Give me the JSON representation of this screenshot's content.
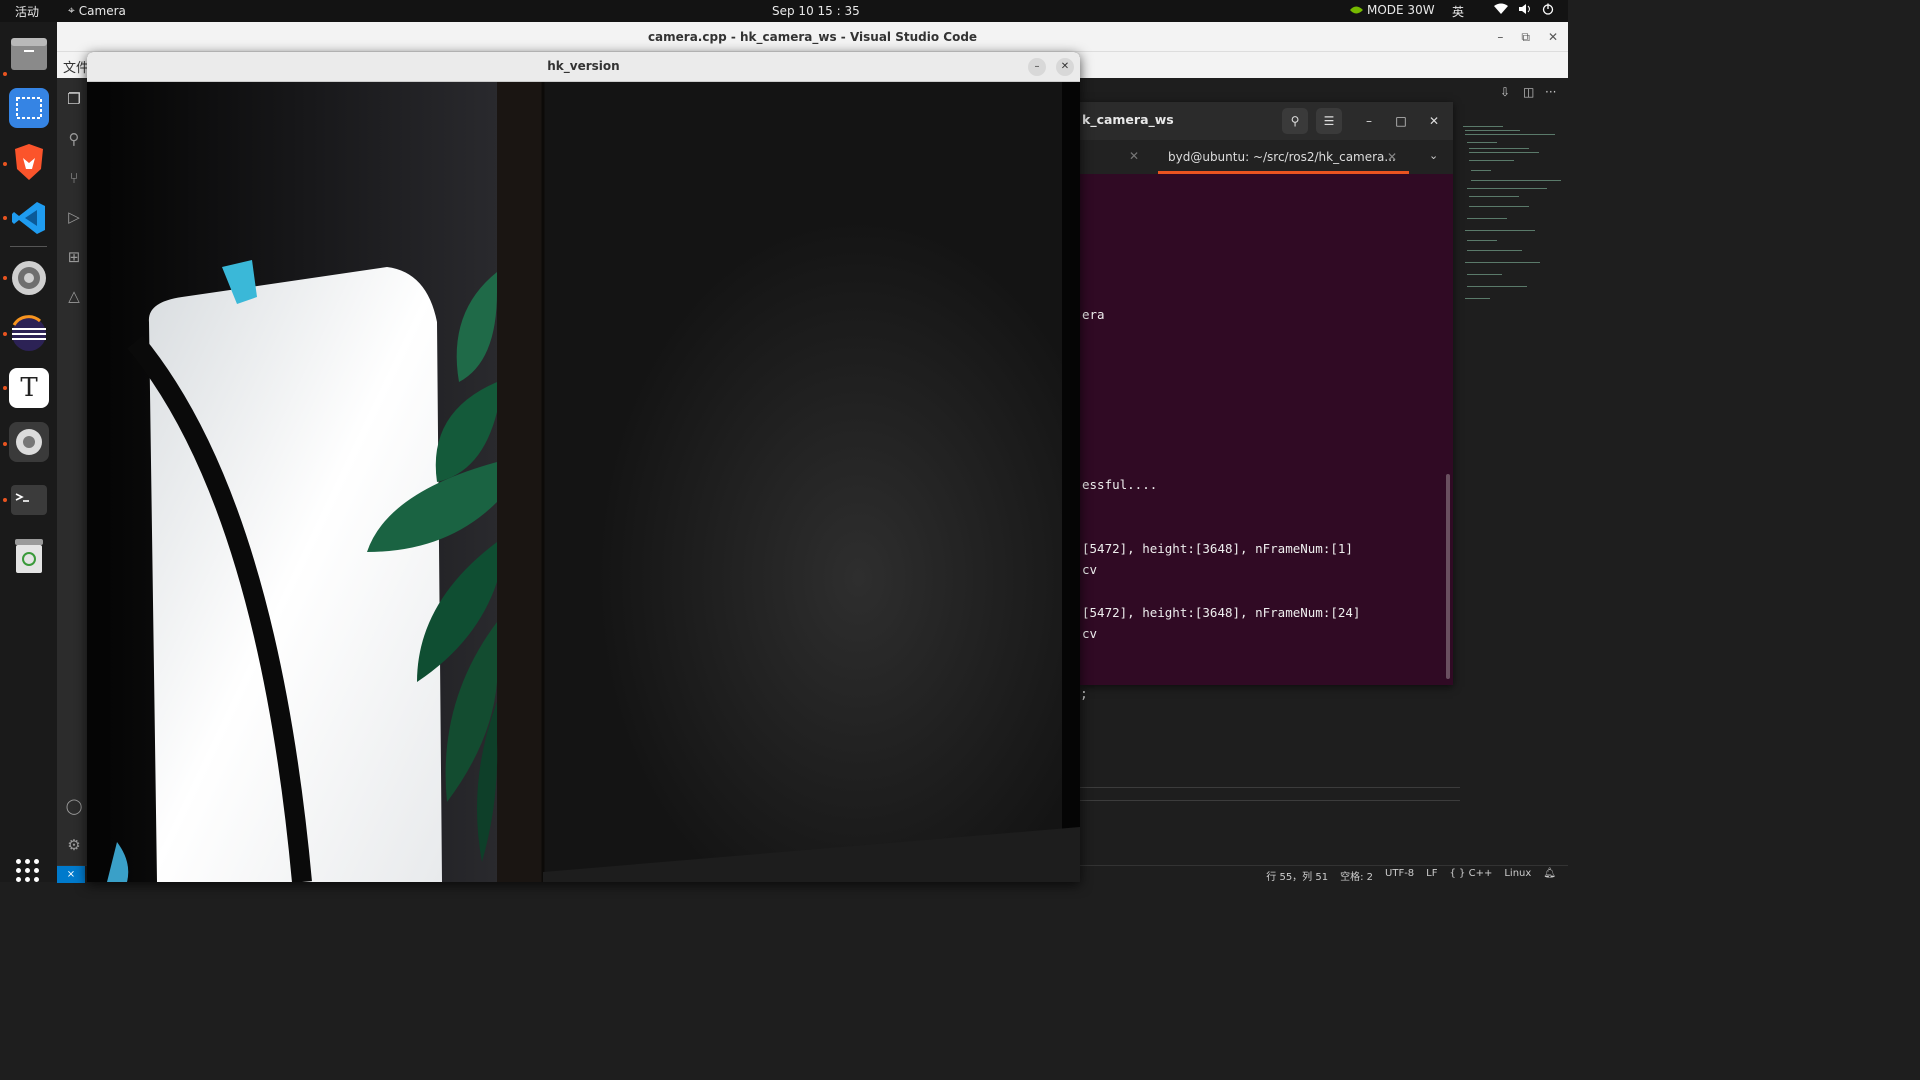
{
  "topbar": {
    "activities": "活动",
    "app_name": "Camera",
    "clock": "Sep 10  15 : 35",
    "mode": "MODE 30W",
    "ime": "英"
  },
  "vscode": {
    "title": "camera.cpp - hk_camera_ws - Visual Studio Code",
    "menu_file": "文件",
    "code_fragment": ";",
    "status": {
      "position": "行 55，列 51",
      "indent": "空格: 2",
      "encoding": "UTF-8",
      "eol": "LF",
      "language": "C++",
      "platform": "Linux"
    }
  },
  "terminal": {
    "title": "k_camera_ws",
    "tab_label": "byd@ubuntu: ~/src/ros2/hk_camera...",
    "lines": [
      "era",
      "essful....",
      "[5472], height:[3648], nFrameNum:[1]",
      "cv",
      "[5472], height:[3648], nFrameNum:[24]",
      "cv"
    ]
  },
  "image_window": {
    "title": "hk_version"
  },
  "colors": {
    "ubuntu_orange": "#e95420",
    "terminal_bg": "#300a24",
    "vscode_blue": "#007acc",
    "nvidia_green": "#76b900"
  }
}
